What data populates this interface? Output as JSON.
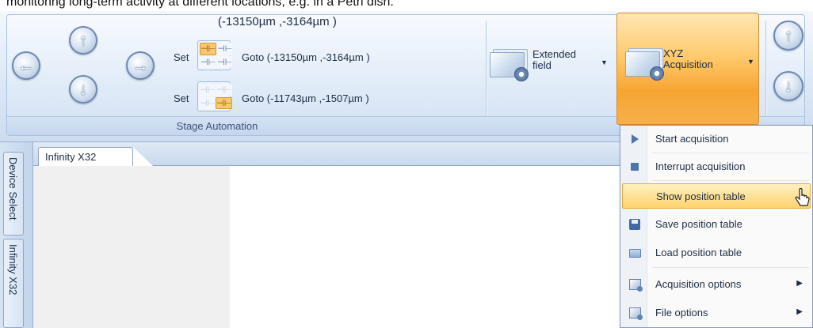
{
  "caption": "monitoring long-term activity at different locations, e.g. in a Petri dish.",
  "ribbon": {
    "group_label": "Stage Automation",
    "current_position": "(-13150µm ,-3164µm )",
    "position_rows": [
      {
        "set_label": "Set",
        "goto_label": "Goto (-13150µm ,-3164µm )"
      },
      {
        "set_label": "Set",
        "goto_label": "Goto (-11743µm ,-1507µm )"
      }
    ],
    "extended_field": {
      "label": "Extended\nfield"
    },
    "xyz_acquisition": {
      "label": "XYZ\nAcquisition"
    }
  },
  "side_tabs": [
    "Device Select",
    "Infinity X32"
  ],
  "document_tab": "Infinity X32",
  "menu": {
    "items": [
      {
        "label": "Start acquisition",
        "icon": "play-icon"
      },
      {
        "label": "Interrupt acquisition",
        "icon": "stop-icon"
      },
      {
        "label": "Show position table",
        "icon": "none",
        "highlighted": true
      },
      {
        "label": "Save position table",
        "icon": "save-disk-icon"
      },
      {
        "label": "Load position table",
        "icon": "open-folder-icon"
      },
      {
        "label": "Acquisition options",
        "icon": "options-icon",
        "submenu": true
      },
      {
        "label": "File options",
        "icon": "options-icon",
        "submenu": true
      }
    ]
  },
  "colors": {
    "ribbon_blue": "#dce8f6",
    "accent_orange": "#f7a532",
    "menu_highlight": "#ffd36e"
  }
}
